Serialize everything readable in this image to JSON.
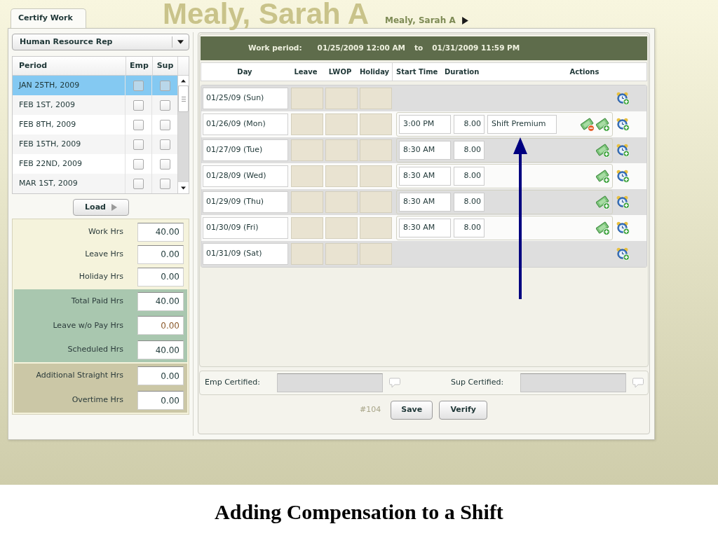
{
  "header": {
    "tab": {
      "label": "Certify Work",
      "selected": true
    },
    "banner_name": "Mealy, Sarah A",
    "employee_name": "Mealy, Sarah A"
  },
  "role_select": {
    "value": "Human Resource Rep"
  },
  "periods": {
    "columns": [
      "Period",
      "Emp",
      "Sup"
    ],
    "rows": [
      {
        "period": "JAN 25TH, 2009",
        "emp": false,
        "sup": false,
        "selected": true
      },
      {
        "period": "FEB 1ST, 2009",
        "emp": false,
        "sup": false,
        "selected": false
      },
      {
        "period": "FEB 8TH, 2009",
        "emp": false,
        "sup": false,
        "selected": false
      },
      {
        "period": "FEB 15TH, 2009",
        "emp": false,
        "sup": false,
        "selected": false
      },
      {
        "period": "FEB 22ND, 2009",
        "emp": false,
        "sup": false,
        "selected": false
      },
      {
        "period": "MAR 1ST, 2009",
        "emp": false,
        "sup": false,
        "selected": false
      }
    ]
  },
  "load_button": "Load",
  "totals": [
    {
      "color": "#f5f3dc",
      "rows": [
        {
          "label": "Work Hrs",
          "value": "40.00",
          "color": "#1e3838"
        },
        {
          "label": "Leave Hrs",
          "value": "0.00",
          "color": "#1e3838"
        },
        {
          "label": "Holiday Hrs",
          "value": "0.00",
          "color": "#1e3838"
        }
      ]
    },
    {
      "color": "#a9c7af",
      "rows": [
        {
          "label": "Total Paid Hrs",
          "value": "40.00",
          "color": "#1e3838"
        },
        {
          "label": "Leave w/o Pay Hrs",
          "value": "0.00",
          "color": "#8b5a2b"
        },
        {
          "label": "Scheduled Hrs",
          "value": "40.00",
          "color": "#1e3838"
        }
      ]
    },
    {
      "color": "#cbc7a6",
      "rows": [
        {
          "label": "Additional Straight Hrs",
          "value": "0.00",
          "color": "#1e3838"
        },
        {
          "label": "Overtime Hrs",
          "value": "0.00",
          "color": "#1e3838"
        }
      ]
    }
  ],
  "work_period": {
    "label": "Work period:",
    "start": "01/25/2009 12:00 AM",
    "separator": "to",
    "end": "01/31/2009 11:59 PM"
  },
  "timesheet": {
    "columns": [
      "Day",
      "Leave",
      "LWOP",
      "Holiday",
      "Start Time",
      "Duration",
      "Actions"
    ],
    "days": [
      {
        "day": "01/25/09 (Sun)"
      },
      {
        "day": "01/26/09 (Mon)",
        "shift": {
          "start_time": "3:00 PM",
          "duration": "8.00",
          "compensation": "Shift Premium"
        }
      },
      {
        "day": "01/27/09 (Tue)",
        "shift": {
          "start_time": "8:30 AM",
          "duration": "8.00"
        }
      },
      {
        "day": "01/28/09 (Wed)",
        "shift": {
          "start_time": "8:30 AM",
          "duration": "8.00"
        }
      },
      {
        "day": "01/29/09 (Thu)",
        "shift": {
          "start_time": "8:30 AM",
          "duration": "8.00"
        }
      },
      {
        "day": "01/30/09 (Fri)",
        "shift": {
          "start_time": "8:30 AM",
          "duration": "8.00"
        }
      },
      {
        "day": "01/31/09 (Sat)"
      }
    ]
  },
  "certification": {
    "emp_label": "Emp Certified:",
    "sup_label": "Sup Certified:"
  },
  "record_number": "#104",
  "buttons": [
    "Save",
    "Verify"
  ],
  "caption": "Adding Compensation to a Shift"
}
